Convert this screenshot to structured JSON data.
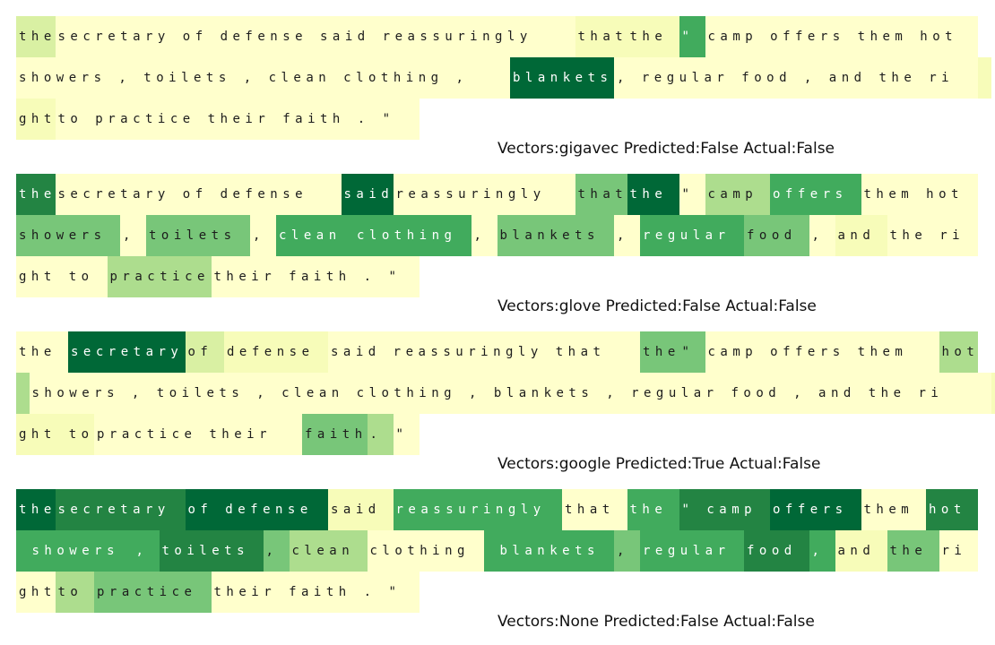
{
  "palette": [
    "#ffffcc",
    "#f7fcb9",
    "#d9f0a3",
    "#addd8e",
    "#78c679",
    "#41ab5d",
    "#238443",
    "#006837"
  ],
  "panels": [
    {
      "caption": "Vectors:gigavec Predicted:False Actual:False",
      "lines": [
        [
          [
            "the",
            2
          ],
          [
            " secretary of defense said reassuringly ",
            0
          ],
          [
            "that",
            1
          ],
          [
            " the",
            1
          ],
          [
            " \"",
            5
          ],
          [
            " camp offers them hot",
            0
          ]
        ],
        [
          [
            " showers , toilets , clean clothing , ",
            0
          ],
          [
            "blankets",
            7
          ],
          [
            " , regular food , and the ri",
            0
          ],
          [
            " ",
            1
          ]
        ],
        [
          [
            "ght",
            1
          ],
          [
            " to practice their faith . \"",
            0
          ]
        ]
      ]
    },
    {
      "caption": "Vectors:glove Predicted:False Actual:False",
      "lines": [
        [
          [
            "the",
            6
          ],
          [
            " secretary of defense ",
            0
          ],
          [
            "said",
            7
          ],
          [
            " reassuringly ",
            0
          ],
          [
            "that",
            4
          ],
          [
            " the",
            7
          ],
          [
            " \"",
            0
          ],
          [
            " camp",
            3
          ],
          [
            " offers",
            5
          ],
          [
            " them hot",
            0
          ]
        ],
        [
          [
            " showers",
            4
          ],
          [
            " ,",
            0
          ],
          [
            " toilets",
            4
          ],
          [
            " ,",
            0
          ],
          [
            " clean",
            5
          ],
          [
            " clothing",
            5
          ],
          [
            " ,",
            0
          ],
          [
            " blankets",
            4
          ],
          [
            " ,",
            0
          ],
          [
            " regular",
            5
          ],
          [
            " food",
            4
          ],
          [
            " ,",
            0
          ],
          [
            " and",
            1
          ],
          [
            " the ri",
            0
          ]
        ],
        [
          [
            "ght to ",
            0
          ],
          [
            "practice",
            3
          ],
          [
            " their faith . \"",
            0
          ]
        ]
      ]
    },
    {
      "caption": "Vectors:google Predicted:True Actual:False",
      "lines": [
        [
          [
            "the ",
            0
          ],
          [
            "secretary",
            7
          ],
          [
            " of",
            2
          ],
          [
            " defense",
            1
          ],
          [
            " said reassuringly that ",
            0
          ],
          [
            "the",
            4
          ],
          [
            " \"",
            4
          ],
          [
            " camp offers them ",
            0
          ],
          [
            "hot",
            3
          ]
        ],
        [
          [
            " ",
            3
          ],
          [
            " showers , toilets , clean clothing , blankets , regular food , and the ri",
            0
          ],
          [
            " ",
            1
          ]
        ],
        [
          [
            "ght to",
            1
          ],
          [
            " practice their ",
            0
          ],
          [
            "faith",
            4
          ],
          [
            " .",
            3
          ],
          [
            " \"",
            0
          ]
        ]
      ]
    },
    {
      "caption": "Vectors:None Predicted:False Actual:False",
      "lines": [
        [
          [
            "the",
            7
          ],
          [
            " secretary",
            6
          ],
          [
            " of defense",
            7
          ],
          [
            " said",
            1
          ],
          [
            " reassuringly",
            5
          ],
          [
            " that",
            0
          ],
          [
            " the",
            5
          ],
          [
            " \" camp",
            6
          ],
          [
            " offers",
            7
          ],
          [
            " them",
            0
          ],
          [
            " hot",
            6
          ]
        ],
        [
          [
            " ",
            5
          ],
          [
            " showers",
            5
          ],
          [
            " ,",
            5
          ],
          [
            " toilets",
            6
          ],
          [
            " ,",
            4
          ],
          [
            " clean",
            3
          ],
          [
            " clothing",
            0
          ],
          [
            " ",
            5
          ],
          [
            " blankets",
            5
          ],
          [
            " ,",
            4
          ],
          [
            " regular",
            5
          ],
          [
            " food",
            6
          ],
          [
            " ,",
            5
          ],
          [
            " and",
            1
          ],
          [
            " the",
            4
          ],
          [
            " ri",
            0
          ]
        ],
        [
          [
            "ght",
            0
          ],
          [
            " to",
            3
          ],
          [
            " practice",
            4
          ],
          [
            " their faith . \"",
            0
          ]
        ]
      ]
    }
  ]
}
